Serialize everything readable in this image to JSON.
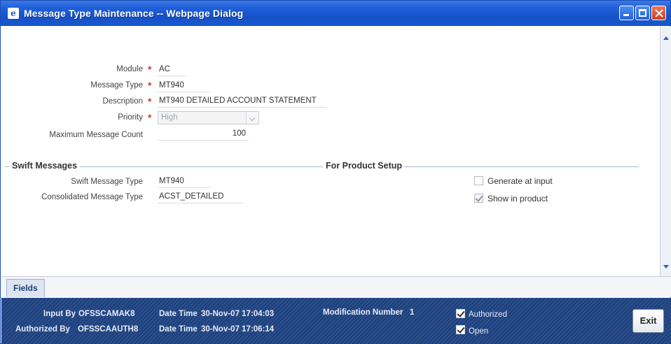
{
  "window": {
    "title": "Message Type Maintenance -- Webpage Dialog",
    "app_icon_glyph": "e"
  },
  "form": {
    "module": {
      "label": "Module",
      "value": "AC"
    },
    "message_type": {
      "label": "Message Type",
      "value": "MT940"
    },
    "description": {
      "label": "Description",
      "value": "MT940 DETAILED ACCOUNT STATEMENT"
    },
    "priority": {
      "label": "Priority",
      "value": "High"
    },
    "max_message_count": {
      "label": "Maximum Message Count",
      "value": "100"
    },
    "required_marker": "*"
  },
  "swift_messages": {
    "heading": "Swift Messages",
    "swift_message_type": {
      "label": "Swift Message Type",
      "value": "MT940"
    },
    "consolidated_message_type": {
      "label": "Consolidated Message Type",
      "value": "ACST_DETAILED"
    }
  },
  "product_setup": {
    "heading": "For Product Setup",
    "generate_at_input": {
      "label": "Generate at input",
      "checked": false
    },
    "show_in_product": {
      "label": "Show in product",
      "checked": true
    }
  },
  "tabs": {
    "fields": "Fields"
  },
  "footer": {
    "input_by_label": "Input By",
    "input_by_value": "OFSSCAMAK8",
    "authorized_by_label": "Authorized By",
    "authorized_by_value": "OFSSCAAUTH8",
    "date_time_label": "Date Time",
    "input_date_time": "30-Nov-07 17:04:03",
    "auth_date_time": "30-Nov-07 17:06:14",
    "modification_label": "Modification Number",
    "modification_value": "1",
    "authorized_label": "Authorized",
    "open_label": "Open",
    "exit_label": "Exit"
  },
  "colors": {
    "titlebar": "#1f5fd8",
    "required": "#e03030",
    "footer": "#2a4f8f"
  }
}
